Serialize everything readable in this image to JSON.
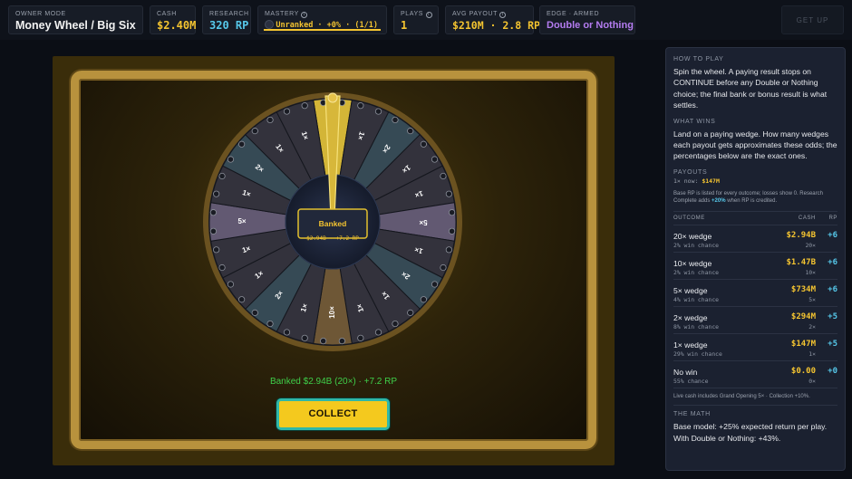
{
  "header": {
    "mode_label": "OWNER MODE",
    "title": "Money Wheel / Big Six",
    "cash_label": "CASH",
    "cash_value": "$2.40M",
    "research_label": "RESEARCH",
    "research_value": "320 RP",
    "mastery_label": "MASTERY",
    "mastery_value": "Unranked · +0% · (1/1)",
    "mastery_progress": 1.0,
    "plays_label": "PLAYS",
    "plays_value": "1",
    "avg_label": "AVG PAYOUT",
    "avg_value": "$210M · 2.8 RP",
    "edge_label": "EDGE · ARMED",
    "edge_value": "Double or Nothing",
    "getup_label": "GET UP"
  },
  "wheel": {
    "center_title": "Banked",
    "center_detail": "$2.94B · +7.2 RP",
    "segments": [
      "20×",
      "1×",
      "2×",
      "1×",
      "1×",
      "5×",
      "1×",
      "2×",
      "1×",
      "1×",
      "10×",
      "1×",
      "2×",
      "1×",
      "1×",
      "5×",
      "1×",
      "2×",
      "1×",
      "1×"
    ],
    "winning_segment": "20×"
  },
  "result": {
    "text": "Banked $2.94B (20×) · +7.2 RP",
    "collect_label": "COLLECT"
  },
  "side": {
    "how_title": "HOW TO PLAY",
    "how_text": "Spin the wheel. A paying result stops on CONTINUE before any Double or Nothing choice; the final bank or bonus result is what settles.",
    "wins_title": "WHAT WINS",
    "wins_text": "Land on a paying wedge. How many wedges each payout gets approximates these odds; the percentages below are the exact ones.",
    "payouts_title": "PAYOUTS",
    "payouts_now": "1× now: $147M",
    "payouts_note": "Base RP is listed for every outcome; losses show 0. Research Complete adds +20% when RP is credited.",
    "col_outcome": "OUTCOME",
    "col_cash": "CASH",
    "col_rp": "RP",
    "rows": [
      {
        "name": "20× wedge",
        "chance": "2% win chance",
        "cash": "$2.94B",
        "mult": "20×",
        "rp": "+6"
      },
      {
        "name": "10× wedge",
        "chance": "2% win chance",
        "cash": "$1.47B",
        "mult": "10×",
        "rp": "+6"
      },
      {
        "name": "5× wedge",
        "chance": "4% win chance",
        "cash": "$734M",
        "mult": "5×",
        "rp": "+6"
      },
      {
        "name": "2× wedge",
        "chance": "8% win chance",
        "cash": "$294M",
        "mult": "2×",
        "rp": "+5"
      },
      {
        "name": "1× wedge",
        "chance": "29% win chance",
        "cash": "$147M",
        "mult": "1×",
        "rp": "+5"
      },
      {
        "name": "No win",
        "chance": "55% chance",
        "cash": "$0.00",
        "mult": "0×",
        "rp": "+0"
      }
    ],
    "live_note": "Live cash includes Grand Opening 5× · Collection +10%.",
    "math_title": "THE MATH",
    "math_text": "Base model: +25% expected return per play. With Double or Nothing: +43%."
  },
  "colors": {
    "gold": "#f4c430",
    "cyan": "#56c8ea",
    "purple": "#b47cf0",
    "green": "#3fcf4a"
  }
}
